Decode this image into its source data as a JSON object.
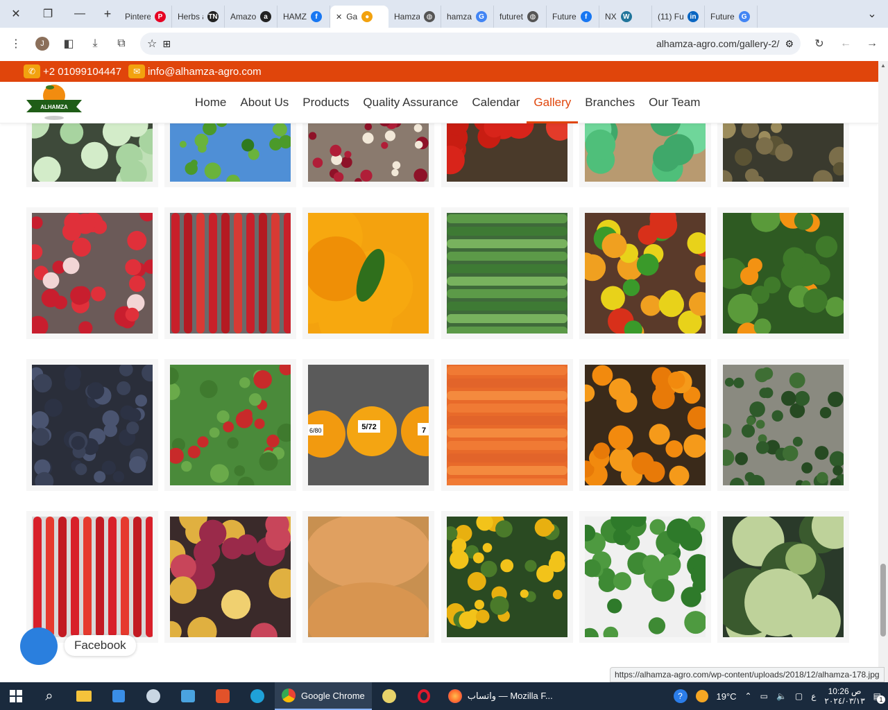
{
  "browser": {
    "tabs": [
      {
        "title": "Pintere",
        "icon": "pinterest-icon",
        "color": "#e60023",
        "glyph": "P"
      },
      {
        "title": "Herbs a",
        "icon": "tn-icon",
        "color": "#222222",
        "glyph": "TN"
      },
      {
        "title": "Amazo",
        "icon": "amazon-icon",
        "color": "#222222",
        "glyph": "a"
      },
      {
        "title": "HAMZ",
        "icon": "facebook-icon",
        "color": "#1877f2",
        "glyph": "f"
      },
      {
        "title": "Ga",
        "icon": "site-icon",
        "color": "#f2a20f",
        "glyph": "●",
        "active": true
      },
      {
        "title": "Hamza",
        "icon": "globe-icon",
        "color": "#555555",
        "glyph": "◍"
      },
      {
        "title": "hamza",
        "icon": "google-icon",
        "color": "#4285f4",
        "glyph": "G"
      },
      {
        "title": "futuret",
        "icon": "globe-icon",
        "color": "#555555",
        "glyph": "◍"
      },
      {
        "title": "Future",
        "icon": "facebook-icon",
        "color": "#1877f2",
        "glyph": "f"
      },
      {
        "title": "NX",
        "icon": "wordpress-icon",
        "color": "#21759b",
        "glyph": "W"
      },
      {
        "title": "(11) Fu",
        "icon": "linkedin-icon",
        "color": "#0a66c2",
        "glyph": "in"
      },
      {
        "title": "Future",
        "icon": "google-icon",
        "color": "#4285f4",
        "glyph": "G"
      }
    ],
    "profile_initial": "J",
    "url": "alhamza-agro.com/gallery-2/",
    "status_url": "https://alhamza-agro.com/wp-content/uploads/2018/12/alhamza-178.jpg"
  },
  "site": {
    "phone": "+2 01099104447",
    "email": "info@alhamza-agro.com",
    "logo_text": "ALHAMZA",
    "nav": [
      "Home",
      "About Us",
      "Products",
      "Quality Assurance",
      "Calendar",
      "Gallery",
      "Branches",
      "Our Team"
    ],
    "active_nav": "Gallery",
    "brand_color": "#e0450b",
    "accent_color": "#f2a20f",
    "facebook_label": "Facebook"
  },
  "gallery": {
    "rows": [
      [
        "iceberg lettuce in crates",
        "coriander in blue bag",
        "open pomegranate",
        "red tomatoes",
        "lettuce in box",
        "pomelo tree"
      ],
      [
        "strawberries in punnets",
        "red chili peppers",
        "orange with leaf",
        "green beans",
        "colored bell peppers",
        "mandarins on tree"
      ],
      [
        "dark plums",
        "peppers on plant",
        "oranges with size labels",
        "carrots",
        "oranges in crate",
        "spinach leaves"
      ],
      [
        "red chili peppers",
        "mangoes in crate",
        "pumpkins",
        "lemons on tree",
        "broccoli in box",
        "cabbage"
      ]
    ],
    "size_labels": [
      "6/80",
      "5/72",
      "7"
    ]
  },
  "taskbar": {
    "apps": [
      {
        "label": "Google Chrome",
        "active": true
      },
      {
        "label": "واتساب — Mozilla F...",
        "active": false
      }
    ],
    "weather": "19°C",
    "lang": "ع",
    "time": "10:26 ص",
    "date": "٢٠٢٤/٠٣/١٣",
    "notification_count": "1"
  }
}
